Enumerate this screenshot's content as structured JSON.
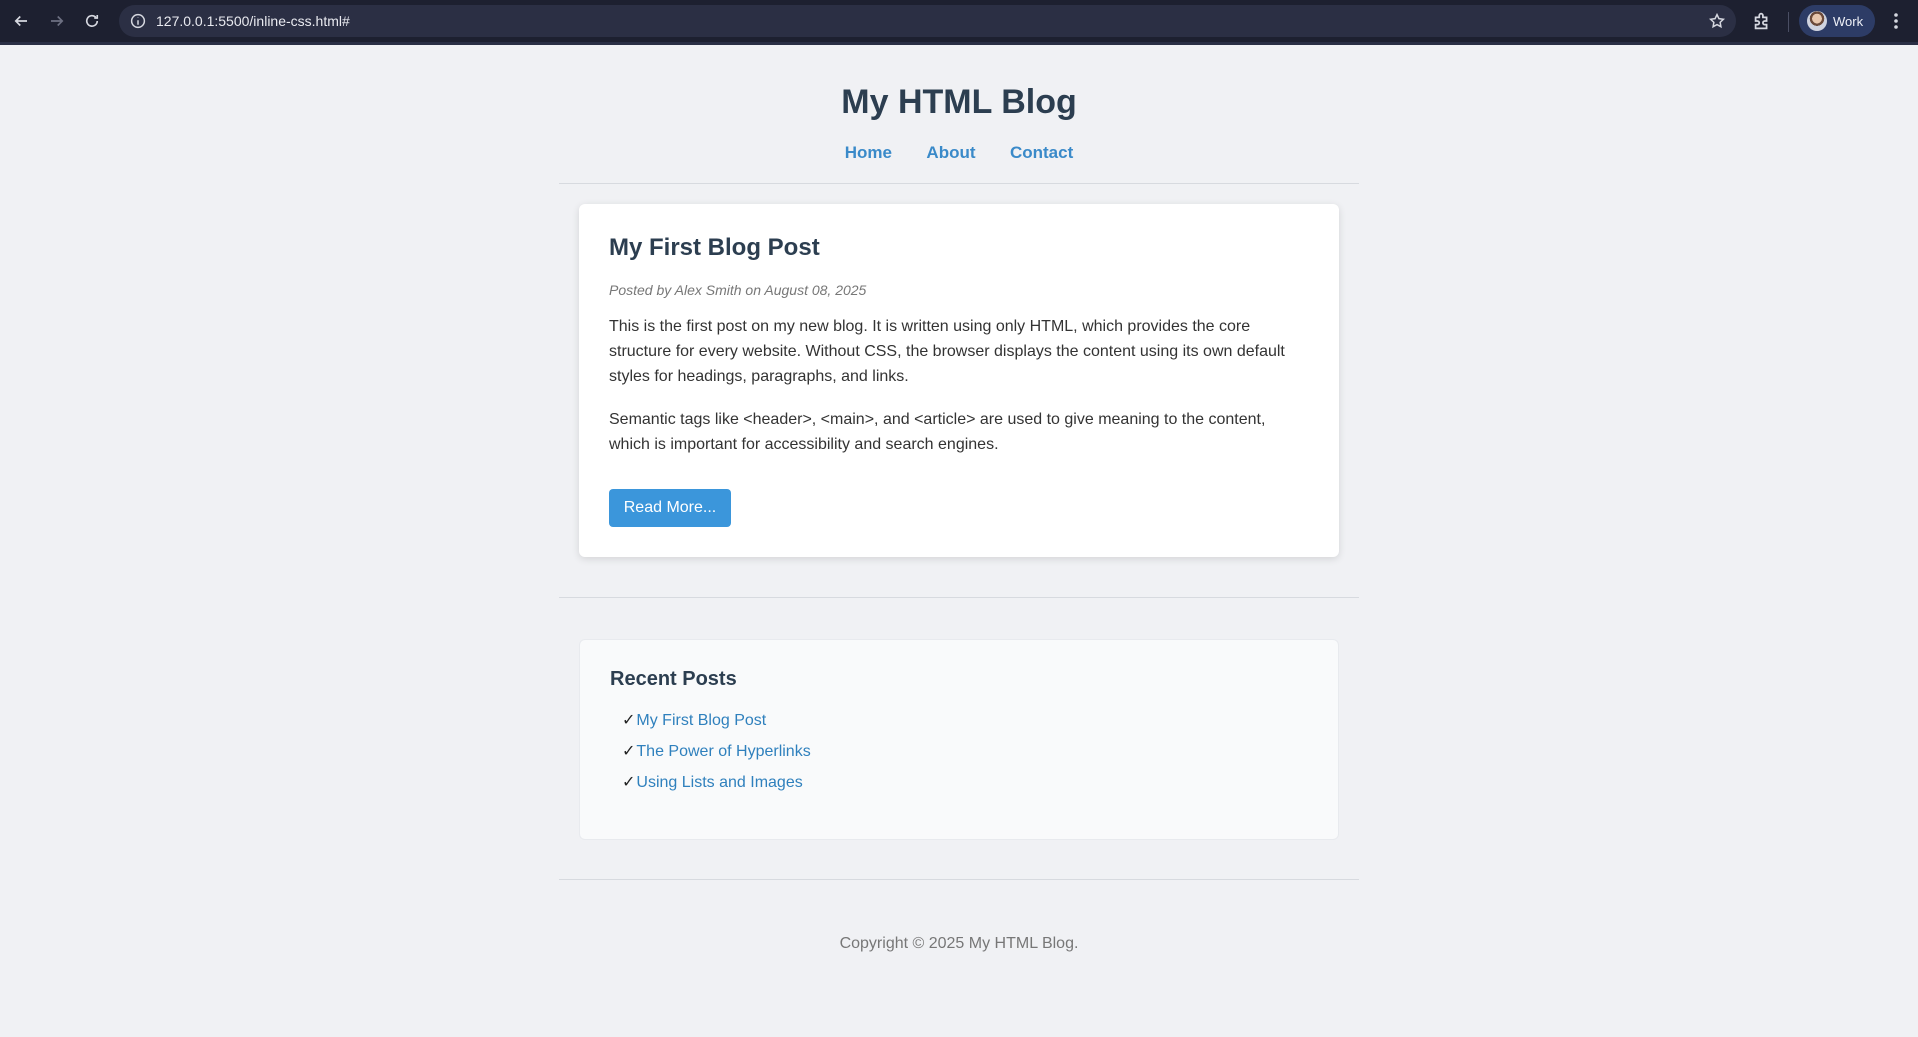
{
  "browser": {
    "url": "127.0.0.1:5500/inline-css.html#",
    "profile_name": "Work",
    "icons": [
      "back-icon",
      "forward-icon",
      "reload-icon",
      "info-icon",
      "star-icon",
      "extensions-icon",
      "kebab-menu-icon"
    ]
  },
  "site": {
    "title": "My HTML Blog",
    "nav": [
      "Home",
      "About",
      "Contact"
    ]
  },
  "post": {
    "title": "My First Blog Post",
    "meta": "Posted by Alex Smith on August 08, 2025",
    "paragraphs": [
      "This is the first post on my new blog. It is written using only HTML, which provides the core structure for every website. Without CSS, the browser displays the content using its own default styles for headings, paragraphs, and links.",
      "Semantic tags like <header>, <main>, and <article> are used to give meaning to the content, which is important for accessibility and search engines."
    ],
    "read_more": "Read More..."
  },
  "recent": {
    "title": "Recent Posts",
    "check": "✓",
    "items": [
      "My First Blog Post",
      "The Power of Hyperlinks",
      "Using Lists and Images"
    ]
  },
  "footer": {
    "text": "Copyright © 2025 My HTML Blog."
  },
  "colors": {
    "accent": "#3b96db",
    "link": "#2f80bd",
    "heading": "#2c3e50",
    "chrome": "#1d2030"
  }
}
